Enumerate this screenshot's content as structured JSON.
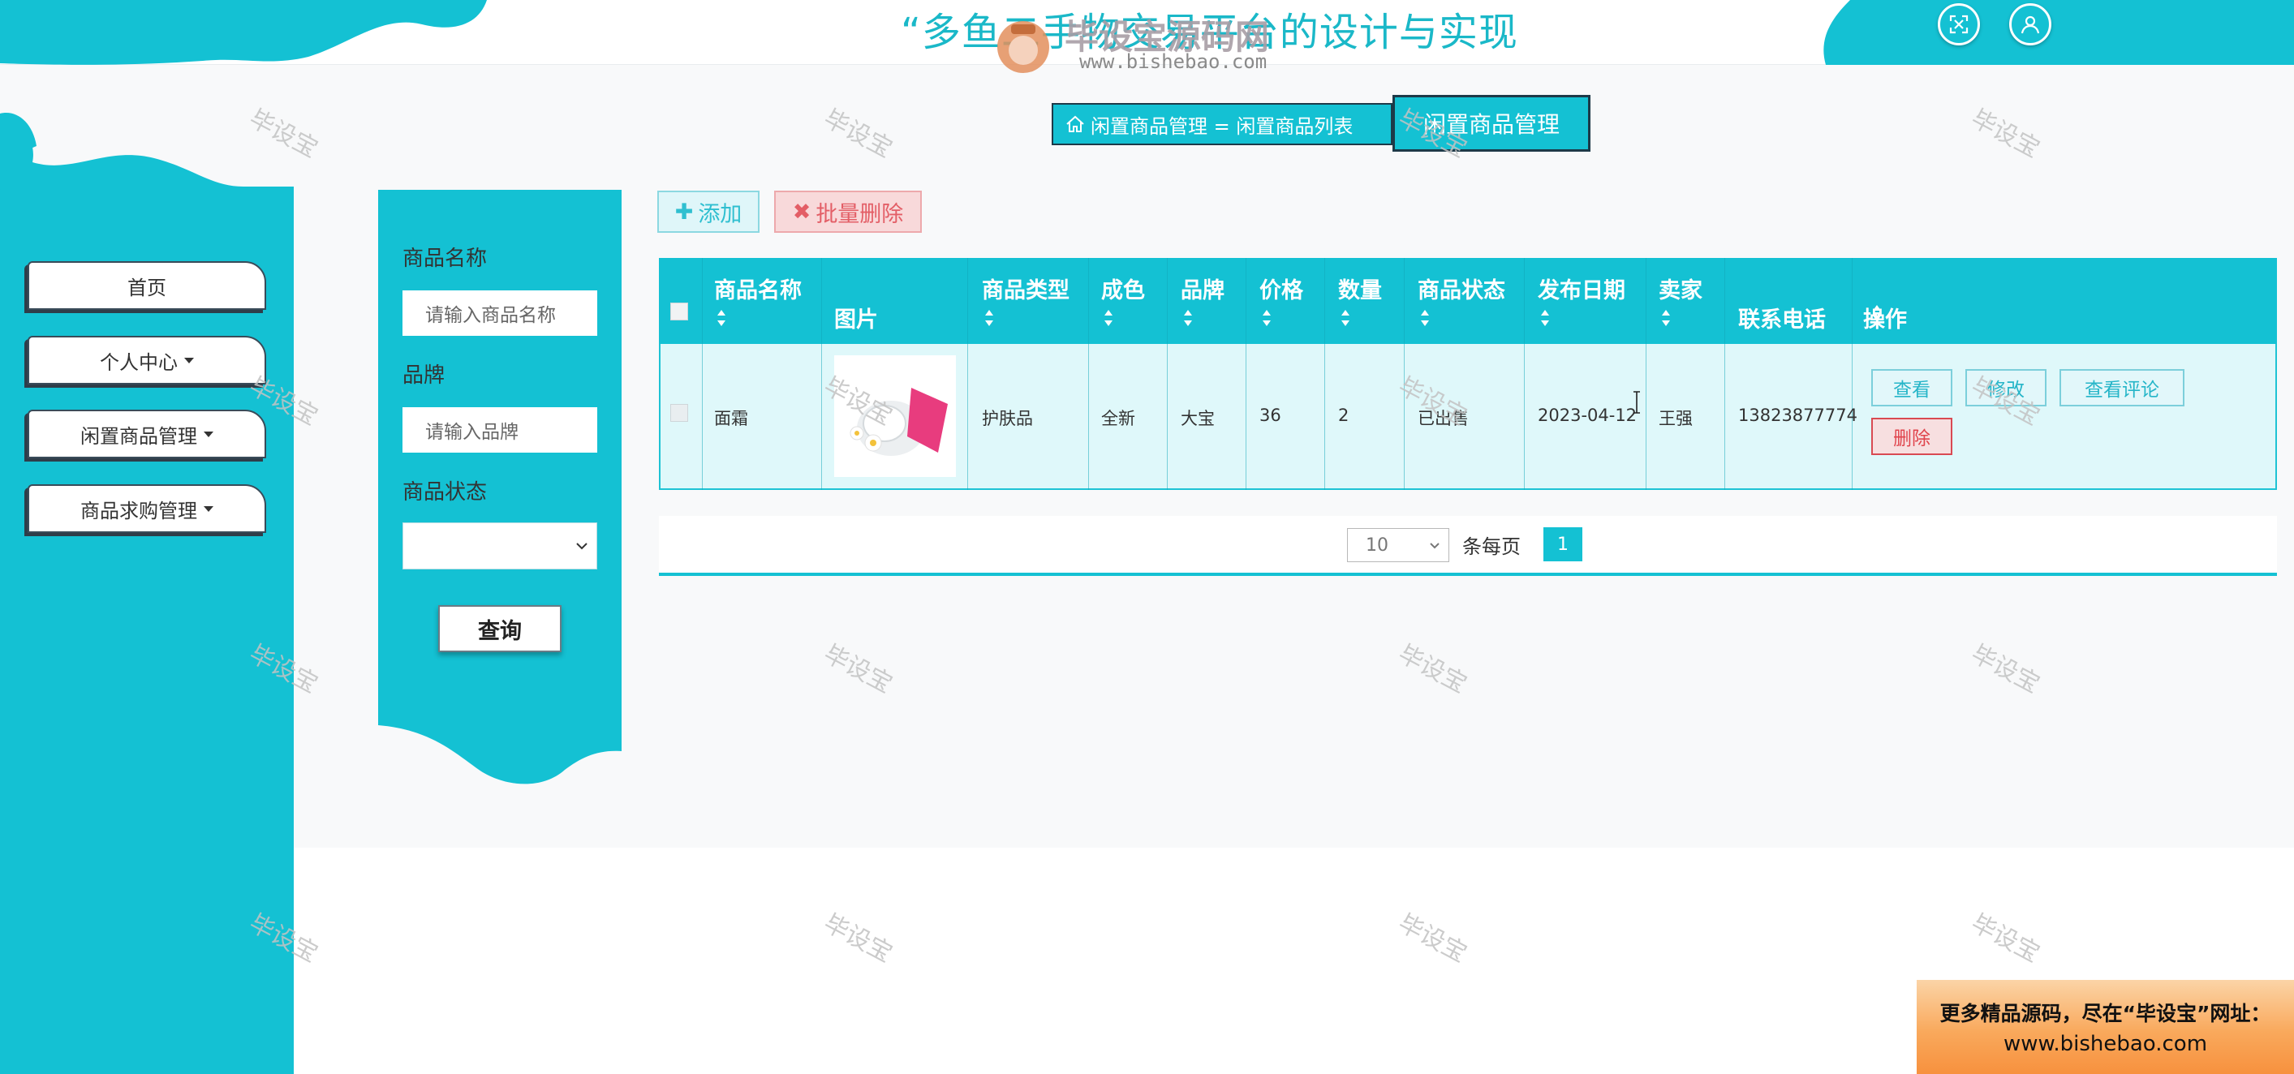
{
  "header": {
    "title": "“多鱼二手物交易平台的设计与实现",
    "fullscreen_icon": "fullscreen-icon",
    "user_icon": "user-icon"
  },
  "watermark_logo": {
    "title": "毕设宝源码网",
    "url": "www.bishebao.com"
  },
  "sidebar": {
    "items": [
      {
        "label": "首页",
        "has_caret": false
      },
      {
        "label": "个人中心",
        "has_caret": true
      },
      {
        "label": "闲置商品管理",
        "has_caret": true
      },
      {
        "label": "商品求购管理",
        "has_caret": true
      }
    ]
  },
  "breadcrumb": {
    "home_icon": "home-icon",
    "path": "闲置商品管理 = 闲置商品列表",
    "current": "闲置商品管理"
  },
  "search": {
    "name_label": "商品名称",
    "name_placeholder": "请输入商品名称",
    "brand_label": "品牌",
    "brand_placeholder": "请输入品牌",
    "status_label": "商品状态",
    "status_value": "",
    "query_label": "查询"
  },
  "actions": {
    "add_label": "添加",
    "bulk_delete_label": "批量删除"
  },
  "table": {
    "columns": [
      "商品名称",
      "图片",
      "商品类型",
      "成色",
      "品牌",
      "价格",
      "数量",
      "商品状态",
      "发布日期",
      "卖家",
      "联系电话",
      "操作"
    ],
    "rows": [
      {
        "name": "面霜",
        "type": "护肤品",
        "condition": "全新",
        "brand": "大宝",
        "price": "36",
        "quantity": "2",
        "status": "已出售",
        "date": "2023-04-12",
        "seller": "王强",
        "phone": "13823877774",
        "ops": [
          "查看",
          "修改",
          "查看评论",
          "删除"
        ]
      }
    ]
  },
  "pagination": {
    "page_size": "10",
    "per_page_label": "条每页",
    "current_page": "1"
  },
  "watermark_text": "毕设宝",
  "promo": {
    "line1": "更多精品源码，尽在“毕设宝”网址：",
    "line2": "www.bishebao.com"
  },
  "colors": {
    "accent": "#14c1d3",
    "row_bg": "#dff8fa",
    "danger": "#e0444c",
    "dark": "#1d3a48"
  }
}
